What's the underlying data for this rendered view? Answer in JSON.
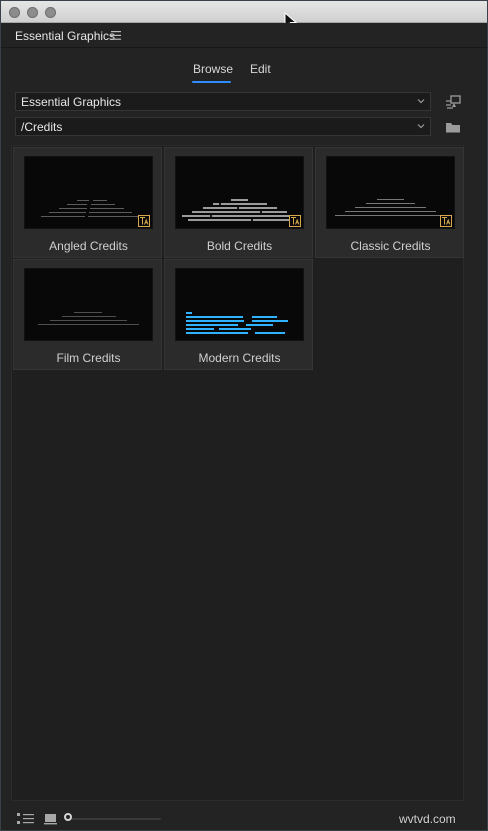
{
  "panel": {
    "title": "Essential Graphics",
    "menu_icon": "hamburger-icon"
  },
  "tabs": [
    {
      "label": "Browse",
      "active": true
    },
    {
      "label": "Edit",
      "active": false
    }
  ],
  "library_dropdown": {
    "value": "Essential Graphics",
    "side_icon": "sync-library-icon"
  },
  "folder_dropdown": {
    "value": "/Credits",
    "side_icon": "folder-icon"
  },
  "templates": [
    {
      "label": "Angled Credits",
      "style": "angled",
      "badge": true
    },
    {
      "label": "Bold Credits",
      "style": "bold",
      "badge": true
    },
    {
      "label": "Classic Credits",
      "style": "classic",
      "badge": true
    },
    {
      "label": "Film Credits",
      "style": "film",
      "badge": false
    },
    {
      "label": "Modern Credits",
      "style": "modern",
      "badge": false
    }
  ],
  "footer": {
    "list_view_icon": "list-view-icon",
    "icon_view_icon": "thumbnail-view-icon",
    "zoom_slider_level": 0
  },
  "watermark": "wvtvd.com",
  "colors": {
    "accent": "#2f8cff",
    "badge": "#d6a84b",
    "panel_background": "#232323",
    "modern_credit_text": "#2fb2ff"
  }
}
